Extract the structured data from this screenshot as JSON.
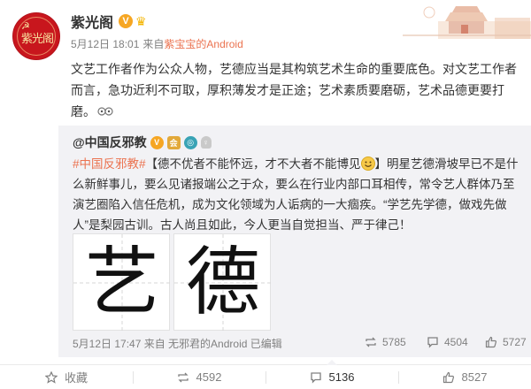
{
  "post": {
    "author": "紫光阁",
    "verified_mark": "V",
    "date": "5月12日 18:01",
    "from_label": "来自",
    "source": "紫宝宝的Android",
    "text": "文艺工作者作为公众人物，艺德应当是其构筑艺术生命的重要底色。对文艺工作者而言，急功近利不可取，厚积薄发才是正途；艺术素质要磨砺，艺术品德更要打磨。",
    "avatar_text": "紫光阁"
  },
  "repost": {
    "author": "@中国反邪教",
    "badges": [
      "V",
      "会",
      "◎",
      "♀"
    ],
    "tag": "#中国反邪教#",
    "text": "【德不优者不能怀远，才不大者不能博见",
    "text_rest": "】明星艺德滑坡早已不是什么新鲜事儿，要么见诸报端公之于众，要么在行业内部口耳相传，常令艺人群体乃至演艺圈陷入信任危机，成为文化领域为人诟病的一大痼疾。“学艺先学德，做戏先做人”是梨园古训。古人尚且如此，今人更当自觉担当、严于律己！",
    "link_icon": "link-icon",
    "images": [
      "艺",
      "德"
    ],
    "time": "5月12日 17:47 来自 无邪君的Android",
    "edited": "已编辑",
    "reposts": "5785",
    "comments": "4504",
    "likes": "5727"
  },
  "toolbar": {
    "favorite": "收藏",
    "repost_count": "4592",
    "comment_count": "5136",
    "like_count": "8527"
  },
  "colors": {
    "accent": "#eb7350",
    "verified": "#f6a623",
    "avatar_red": "#c8161d",
    "repost_bg": "#f2f2f5"
  }
}
